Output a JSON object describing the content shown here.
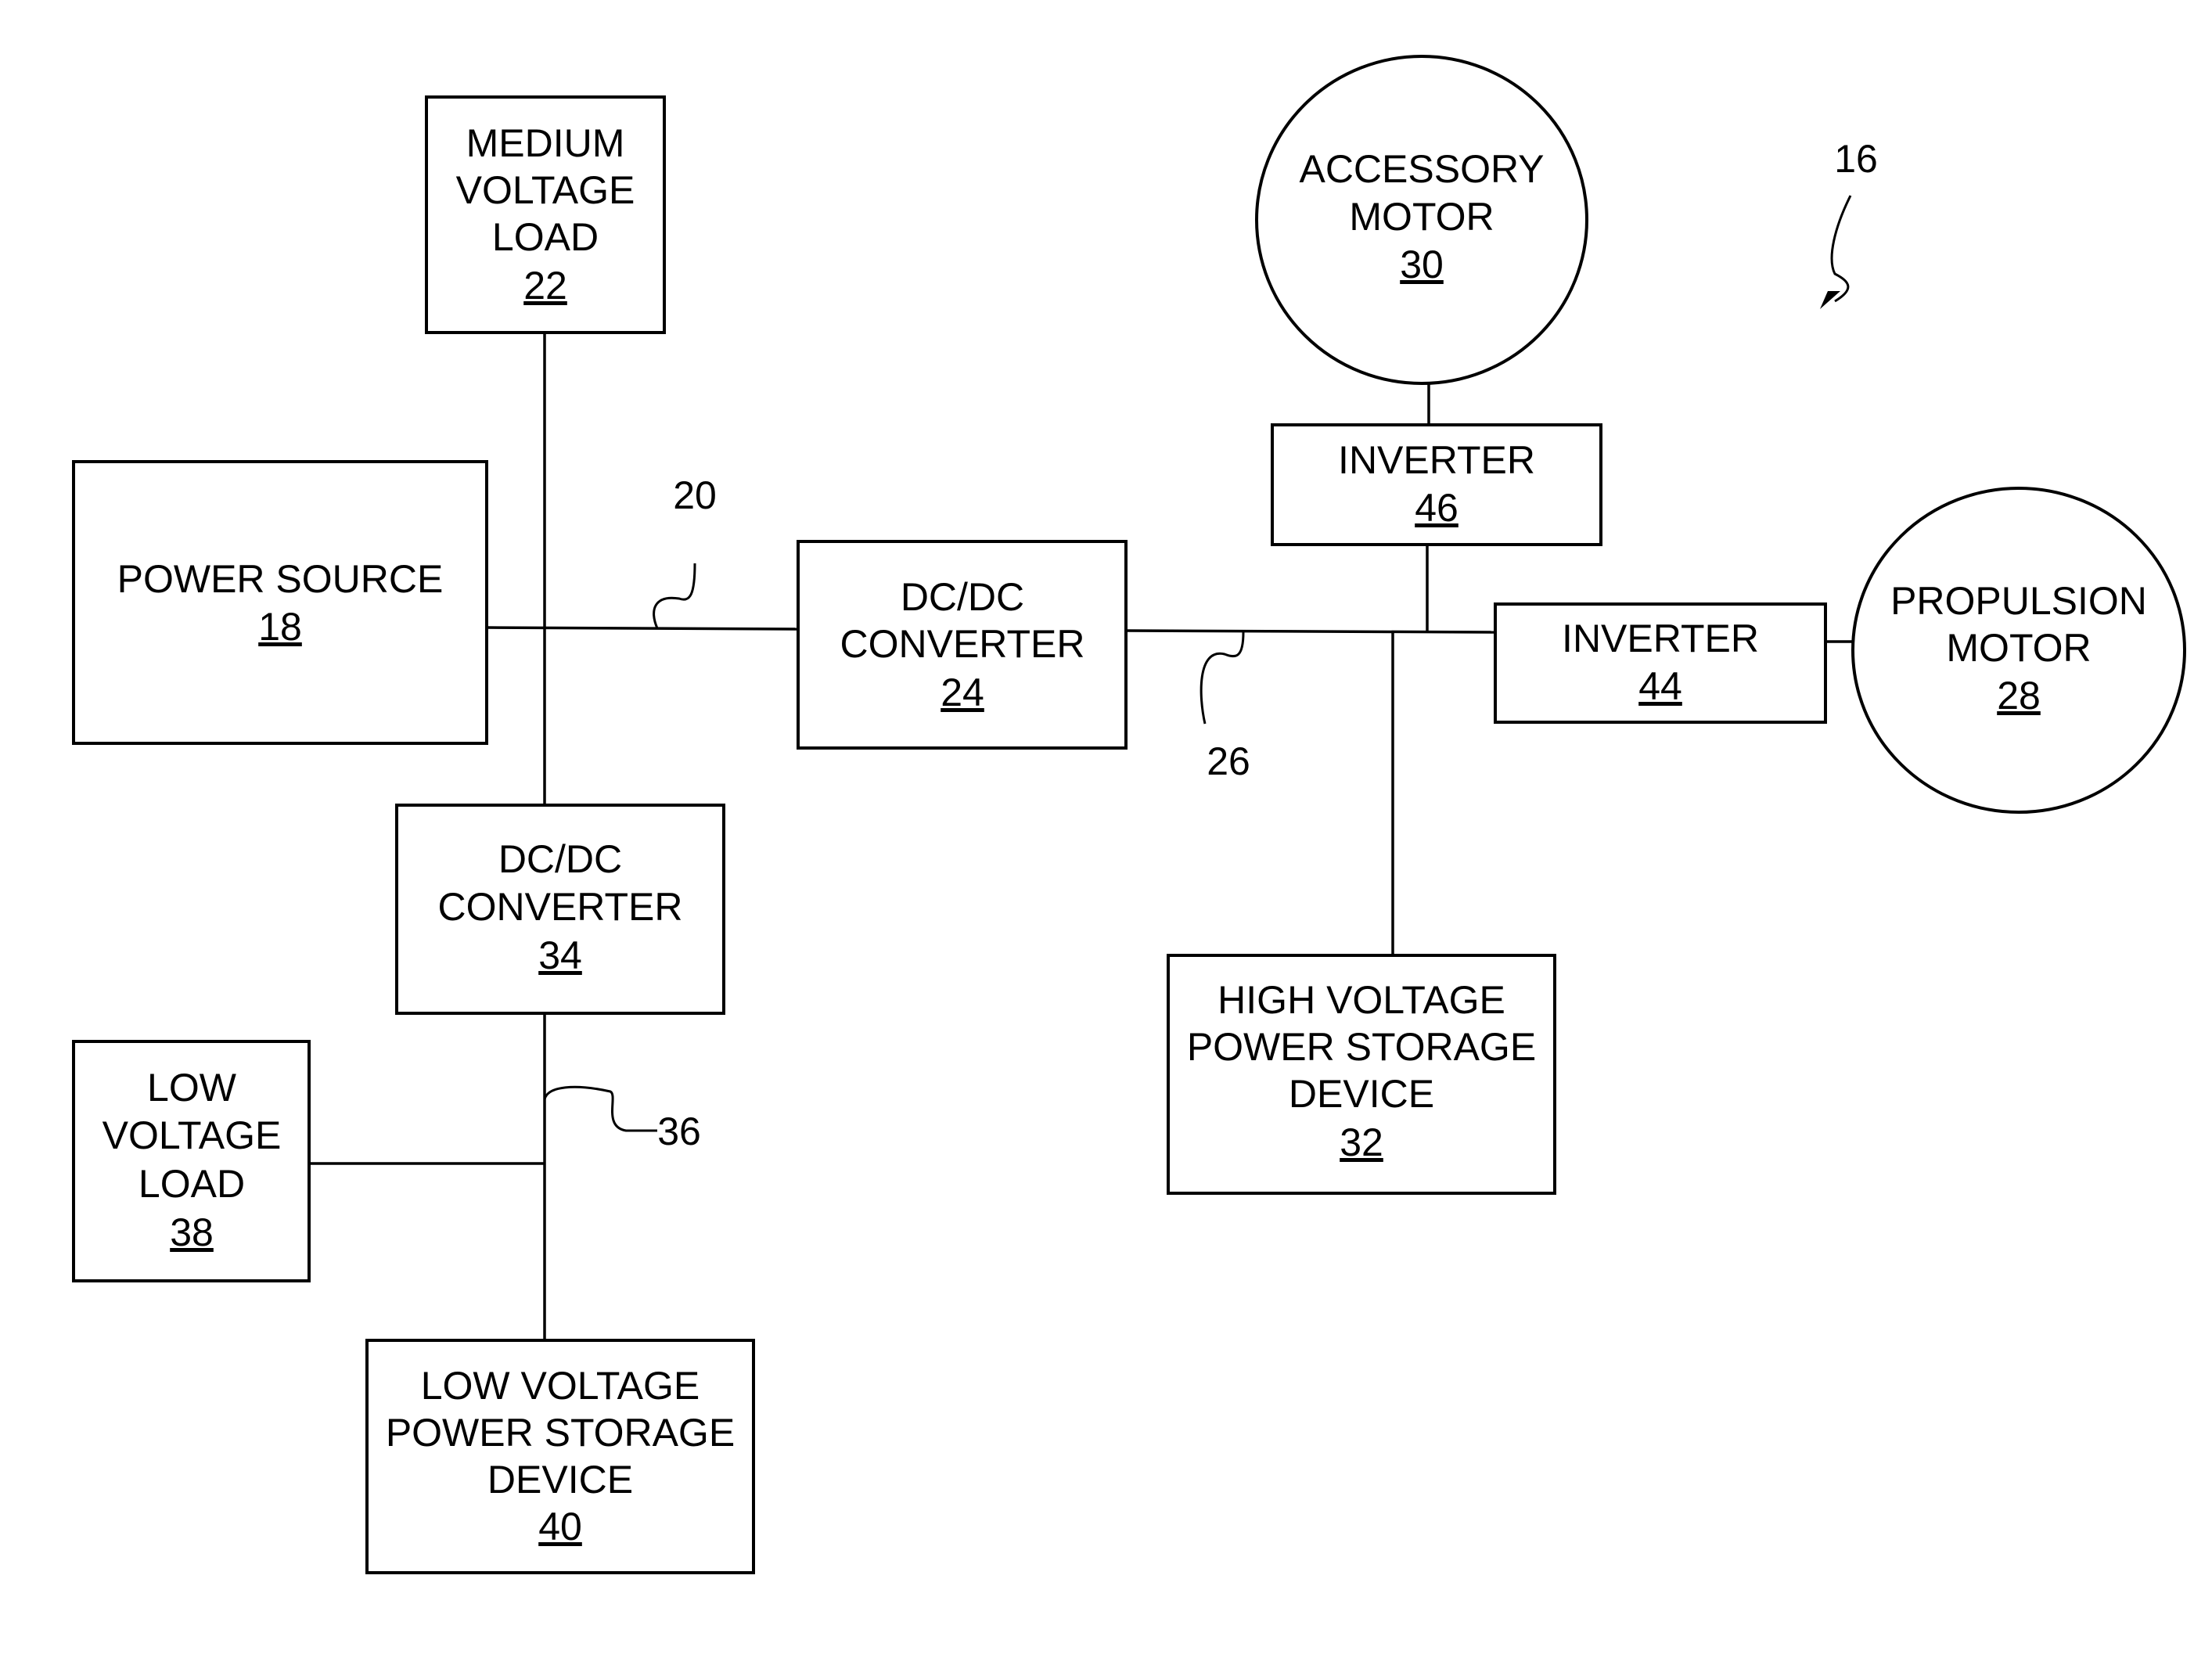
{
  "figure": {
    "reference": "16",
    "components": {
      "power_source": {
        "lines": [
          "POWER SOURCE"
        ],
        "ref": "18"
      },
      "medium_voltage_load": {
        "lines": [
          "MEDIUM",
          "VOLTAGE",
          "LOAD"
        ],
        "ref": "22"
      },
      "dcdc_converter_24": {
        "lines": [
          "DC/DC",
          "CONVERTER"
        ],
        "ref": "24"
      },
      "accessory_motor": {
        "lines": [
          "ACCESSORY",
          "MOTOR"
        ],
        "ref": "30"
      },
      "inverter_46": {
        "lines": [
          "INVERTER"
        ],
        "ref": "46"
      },
      "inverter_44": {
        "lines": [
          "INVERTER"
        ],
        "ref": "44"
      },
      "propulsion_motor": {
        "lines": [
          "PROPULSION",
          "MOTOR"
        ],
        "ref": "28"
      },
      "hv_storage": {
        "lines": [
          "HIGH VOLTAGE",
          "POWER STORAGE",
          "DEVICE"
        ],
        "ref": "32"
      },
      "dcdc_converter_34": {
        "lines": [
          "DC/DC",
          "CONVERTER"
        ],
        "ref": "34"
      },
      "low_voltage_load": {
        "lines": [
          "LOW",
          "VOLTAGE",
          "LOAD"
        ],
        "ref": "38"
      },
      "lv_storage": {
        "lines": [
          "LOW VOLTAGE",
          "POWER STORAGE",
          "DEVICE"
        ],
        "ref": "40"
      }
    },
    "bus_callouts": {
      "medium_voltage_bus": "20",
      "high_voltage_bus": "26",
      "low_voltage_bus": "36"
    }
  }
}
